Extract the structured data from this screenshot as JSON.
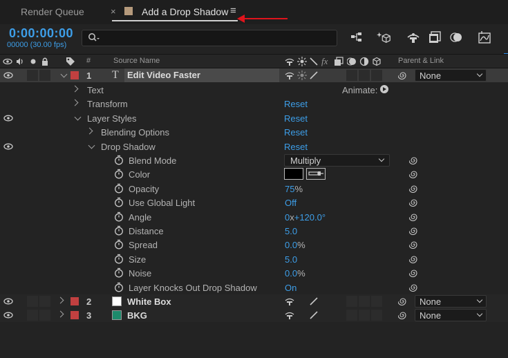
{
  "tabs": {
    "render_queue": "Render Queue",
    "close_glyph": "×",
    "active": "Add a Drop Shadow",
    "menu_glyph": "≡"
  },
  "timeline": {
    "timecode": "0:00:00:00",
    "frames": "00000 (30.00 fps)",
    "search_placeholder": ""
  },
  "columns": {
    "num": "#",
    "source_name": "Source Name",
    "parent": "Parent & Link"
  },
  "colors": {
    "accent_blue": "#3d9ee8",
    "label_red": "#c14040",
    "annotation_arrow": "#e0141c",
    "white_box": "#ffffff",
    "bkg_swatch": "#1d8a6b"
  },
  "layers": [
    {
      "num": "1",
      "name": "Edit Video Faster",
      "parent": "None"
    },
    {
      "num": "2",
      "name": "White Box",
      "parent": "None"
    },
    {
      "num": "3",
      "name": "BKG",
      "parent": "None"
    }
  ],
  "groups": {
    "text": "Text",
    "transform": "Transform",
    "layer_styles": "Layer Styles",
    "blending_options": "Blending Options",
    "drop_shadow": "Drop Shadow",
    "reset": "Reset",
    "animate": "Animate:"
  },
  "drop_shadow_props": [
    {
      "name": "Blend Mode",
      "value": "Multiply"
    },
    {
      "name": "Color",
      "value": ""
    },
    {
      "name": "Opacity",
      "value": "75",
      "unit": "%"
    },
    {
      "name": "Use Global Light",
      "value": "Off"
    },
    {
      "name": "Angle",
      "value_pre": "0",
      "unit": "x",
      "value": "+120.0°"
    },
    {
      "name": "Distance",
      "value": "5.0"
    },
    {
      "name": "Spread",
      "value": "0.0",
      "unit": "%"
    },
    {
      "name": "Size",
      "value": "5.0"
    },
    {
      "name": "Noise",
      "value": "0.0",
      "unit": "%"
    },
    {
      "name": "Layer Knocks Out Drop Shadow",
      "value": "On"
    }
  ]
}
